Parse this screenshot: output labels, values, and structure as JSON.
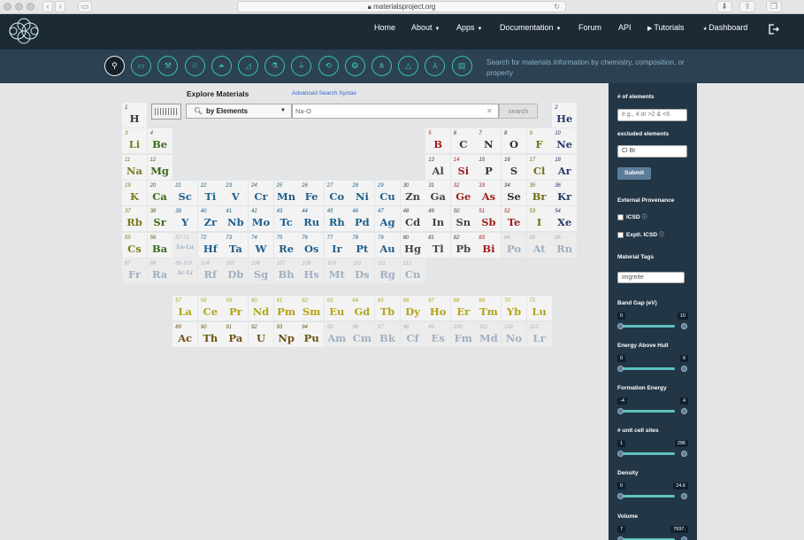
{
  "browser": {
    "url": "materialsproject.org"
  },
  "nav": {
    "links": [
      {
        "label": "Home",
        "caret": false,
        "icon": ""
      },
      {
        "label": "About",
        "caret": true,
        "icon": ""
      },
      {
        "label": "Apps",
        "caret": true,
        "icon": ""
      },
      {
        "label": "Documentation",
        "caret": true,
        "icon": ""
      },
      {
        "label": "Forum",
        "caret": false,
        "icon": ""
      },
      {
        "label": "API",
        "caret": false,
        "icon": ""
      },
      {
        "label": "Tutorials",
        "caret": false,
        "icon": "video-icon"
      },
      {
        "label": "Dashboard",
        "caret": false,
        "icon": "dashboard-icon"
      }
    ],
    "logout_icon": "logout-icon"
  },
  "toolbar": {
    "tools": [
      "search-icon",
      "battery-icon",
      "tools-icon",
      "recycle-icon",
      "flask-icon",
      "diagram-icon",
      "beaker-icon",
      "tube-icon",
      "refresh-icon",
      "crystal-icon",
      "nodes-icon",
      "triangle-flask-icon",
      "chart-icon",
      "database-icon"
    ],
    "hint": "Search for materials information by chemistry, composition, or property"
  },
  "explore": {
    "title": "Explore Materials",
    "advanced_link": "Advanced Search Syntax",
    "mode": "by Elements",
    "query": "Na-O",
    "search_label": "search"
  },
  "colors": {
    "nonmetal": "#333333",
    "alkali": "#7a7a1f",
    "alkaline": "#3e6a1a",
    "transition": "#1f5f8b",
    "post_transition": "#444444",
    "metalloid": "#9e1f1f",
    "halogen": "#6f6f13",
    "noble": "#283c6b",
    "lanthanide": "#b2a418",
    "actinide": "#6e5214",
    "faded": "#9fb0c3"
  },
  "elements": [
    [
      "1",
      "H",
      1,
      1,
      "nonmetal"
    ],
    [
      "2",
      "He",
      18,
      1,
      "noble"
    ],
    [
      "3",
      "Li",
      1,
      2,
      "alkali"
    ],
    [
      "4",
      "Be",
      2,
      2,
      "alkaline"
    ],
    [
      "5",
      "B",
      13,
      2,
      "metalloid"
    ],
    [
      "6",
      "C",
      14,
      2,
      "nonmetal"
    ],
    [
      "7",
      "N",
      15,
      2,
      "nonmetal"
    ],
    [
      "8",
      "O",
      16,
      2,
      "nonmetal"
    ],
    [
      "9",
      "F",
      17,
      2,
      "halogen"
    ],
    [
      "10",
      "Ne",
      18,
      2,
      "noble"
    ],
    [
      "11",
      "Na",
      1,
      3,
      "alkali"
    ],
    [
      "12",
      "Mg",
      2,
      3,
      "alkaline"
    ],
    [
      "13",
      "Al",
      13,
      3,
      "post_transition"
    ],
    [
      "14",
      "Si",
      14,
      3,
      "metalloid"
    ],
    [
      "15",
      "P",
      15,
      3,
      "nonmetal"
    ],
    [
      "16",
      "S",
      16,
      3,
      "nonmetal"
    ],
    [
      "17",
      "Cl",
      17,
      3,
      "halogen"
    ],
    [
      "18",
      "Ar",
      18,
      3,
      "noble"
    ],
    [
      "19",
      "K",
      1,
      4,
      "alkali"
    ],
    [
      "20",
      "Ca",
      2,
      4,
      "alkaline"
    ],
    [
      "21",
      "Sc",
      3,
      4,
      "transition"
    ],
    [
      "22",
      "Ti",
      4,
      4,
      "transition"
    ],
    [
      "23",
      "V",
      5,
      4,
      "transition"
    ],
    [
      "24",
      "Cr",
      6,
      4,
      "transition"
    ],
    [
      "25",
      "Mn",
      7,
      4,
      "transition"
    ],
    [
      "26",
      "Fe",
      8,
      4,
      "transition"
    ],
    [
      "27",
      "Co",
      9,
      4,
      "transition"
    ],
    [
      "28",
      "Ni",
      10,
      4,
      "transition"
    ],
    [
      "29",
      "Cu",
      11,
      4,
      "transition"
    ],
    [
      "30",
      "Zn",
      12,
      4,
      "post_transition"
    ],
    [
      "31",
      "Ga",
      13,
      4,
      "post_transition"
    ],
    [
      "32",
      "Ge",
      14,
      4,
      "metalloid"
    ],
    [
      "33",
      "As",
      15,
      4,
      "metalloid"
    ],
    [
      "34",
      "Se",
      16,
      4,
      "nonmetal"
    ],
    [
      "35",
      "Br",
      17,
      4,
      "halogen"
    ],
    [
      "36",
      "Kr",
      18,
      4,
      "noble"
    ],
    [
      "37",
      "Rb",
      1,
      5,
      "alkali"
    ],
    [
      "38",
      "Sr",
      2,
      5,
      "alkaline"
    ],
    [
      "39",
      "Y",
      3,
      5,
      "transition"
    ],
    [
      "40",
      "Zr",
      4,
      5,
      "transition"
    ],
    [
      "41",
      "Nb",
      5,
      5,
      "transition"
    ],
    [
      "42",
      "Mo",
      6,
      5,
      "transition"
    ],
    [
      "43",
      "Tc",
      7,
      5,
      "transition"
    ],
    [
      "44",
      "Ru",
      8,
      5,
      "transition"
    ],
    [
      "45",
      "Rh",
      9,
      5,
      "transition"
    ],
    [
      "46",
      "Pd",
      10,
      5,
      "transition"
    ],
    [
      "47",
      "Ag",
      11,
      5,
      "transition"
    ],
    [
      "48",
      "Cd",
      12,
      5,
      "post_transition"
    ],
    [
      "49",
      "In",
      13,
      5,
      "post_transition"
    ],
    [
      "50",
      "Sn",
      14,
      5,
      "post_transition"
    ],
    [
      "51",
      "Sb",
      15,
      5,
      "metalloid"
    ],
    [
      "52",
      "Te",
      16,
      5,
      "metalloid"
    ],
    [
      "53",
      "I",
      17,
      5,
      "halogen"
    ],
    [
      "54",
      "Xe",
      18,
      5,
      "noble"
    ],
    [
      "55",
      "Cs",
      1,
      6,
      "alkali"
    ],
    [
      "56",
      "Ba",
      2,
      6,
      "alkaline"
    ],
    [
      "57-71",
      "La-Lu",
      3,
      6,
      "faded"
    ],
    [
      "72",
      "Hf",
      4,
      6,
      "transition"
    ],
    [
      "73",
      "Ta",
      5,
      6,
      "transition"
    ],
    [
      "74",
      "W",
      6,
      6,
      "transition"
    ],
    [
      "75",
      "Re",
      7,
      6,
      "transition"
    ],
    [
      "76",
      "Os",
      8,
      6,
      "transition"
    ],
    [
      "77",
      "Ir",
      9,
      6,
      "transition"
    ],
    [
      "78",
      "Pt",
      10,
      6,
      "transition"
    ],
    [
      "79",
      "Au",
      11,
      6,
      "transition"
    ],
    [
      "80",
      "Hg",
      12,
      6,
      "post_transition"
    ],
    [
      "81",
      "Tl",
      13,
      6,
      "post_transition"
    ],
    [
      "82",
      "Pb",
      14,
      6,
      "post_transition"
    ],
    [
      "83",
      "Bi",
      15,
      6,
      "metalloid"
    ],
    [
      "84",
      "Po",
      16,
      6,
      "faded"
    ],
    [
      "85",
      "At",
      17,
      6,
      "faded"
    ],
    [
      "86",
      "Rn",
      18,
      6,
      "faded"
    ],
    [
      "87",
      "Fr",
      1,
      7,
      "faded"
    ],
    [
      "88",
      "Ra",
      2,
      7,
      "faded"
    ],
    [
      "89-103",
      "Ac-Lr",
      3,
      7,
      "faded"
    ],
    [
      "104",
      "Rf",
      4,
      7,
      "faded"
    ],
    [
      "105",
      "Db",
      5,
      7,
      "faded"
    ],
    [
      "106",
      "Sg",
      6,
      7,
      "faded"
    ],
    [
      "107",
      "Bh",
      7,
      7,
      "faded"
    ],
    [
      "108",
      "Hs",
      8,
      7,
      "faded"
    ],
    [
      "109",
      "Mt",
      9,
      7,
      "faded"
    ],
    [
      "110",
      "Ds",
      10,
      7,
      "faded"
    ],
    [
      "111",
      "Rg",
      11,
      7,
      "faded"
    ],
    [
      "112",
      "Cn",
      12,
      7,
      "faded"
    ],
    [
      "57",
      "La",
      3,
      9,
      "lanthanide"
    ],
    [
      "58",
      "Ce",
      4,
      9,
      "lanthanide"
    ],
    [
      "59",
      "Pr",
      5,
      9,
      "lanthanide"
    ],
    [
      "60",
      "Nd",
      6,
      9,
      "lanthanide"
    ],
    [
      "61",
      "Pm",
      7,
      9,
      "lanthanide"
    ],
    [
      "62",
      "Sm",
      8,
      9,
      "lanthanide"
    ],
    [
      "63",
      "Eu",
      9,
      9,
      "lanthanide"
    ],
    [
      "64",
      "Gd",
      10,
      9,
      "lanthanide"
    ],
    [
      "65",
      "Tb",
      11,
      9,
      "lanthanide"
    ],
    [
      "66",
      "Dy",
      12,
      9,
      "lanthanide"
    ],
    [
      "67",
      "Ho",
      13,
      9,
      "lanthanide"
    ],
    [
      "68",
      "Er",
      14,
      9,
      "lanthanide"
    ],
    [
      "69",
      "Tm",
      15,
      9,
      "lanthanide"
    ],
    [
      "70",
      "Yb",
      16,
      9,
      "lanthanide"
    ],
    [
      "71",
      "Lu",
      17,
      9,
      "lanthanide"
    ],
    [
      "89",
      "Ac",
      3,
      10,
      "actinide"
    ],
    [
      "90",
      "Th",
      4,
      10,
      "actinide"
    ],
    [
      "91",
      "Pa",
      5,
      10,
      "actinide"
    ],
    [
      "92",
      "U",
      6,
      10,
      "actinide"
    ],
    [
      "93",
      "Np",
      7,
      10,
      "actinide"
    ],
    [
      "94",
      "Pu",
      8,
      10,
      "actinide"
    ],
    [
      "95",
      "Am",
      9,
      10,
      "faded"
    ],
    [
      "96",
      "Cm",
      10,
      10,
      "faded"
    ],
    [
      "97",
      "Bk",
      11,
      10,
      "faded"
    ],
    [
      "98",
      "Cf",
      12,
      10,
      "faded"
    ],
    [
      "99",
      "Es",
      13,
      10,
      "faded"
    ],
    [
      "100",
      "Fm",
      14,
      10,
      "faded"
    ],
    [
      "101",
      "Md",
      15,
      10,
      "faded"
    ],
    [
      "102",
      "No",
      16,
      10,
      "faded"
    ],
    [
      "103",
      "Lr",
      17,
      10,
      "faded"
    ]
  ],
  "sidebar": {
    "num_elements_label": "# of elements",
    "num_elements_placeholder": "e.g., 4 or >2 & <6",
    "excluded_label": "excluded elements",
    "excluded_value": "Cl Br",
    "submit_label": "Submit",
    "provenance_label": "External Provenance",
    "icsd_label": "ICSD",
    "exptl_icsd_label": "Exptl. ICSD",
    "help_icon": "help-icon",
    "tags_label": "Material Tags",
    "tags_value": "imgreite",
    "sliders": [
      {
        "label": "Band Gap (eV)",
        "min": "0",
        "max": "10"
      },
      {
        "label": "Energy Above Hull",
        "min": "0",
        "max": "6"
      },
      {
        "label": "Formation Energy",
        "min": "-4",
        "max": "4"
      },
      {
        "label": "# unit cell sites",
        "min": "1",
        "max": "296"
      },
      {
        "label": "Density",
        "min": "0",
        "max": "24.6"
      },
      {
        "label": "Volume",
        "min": "7",
        "max": "7697."
      }
    ]
  }
}
